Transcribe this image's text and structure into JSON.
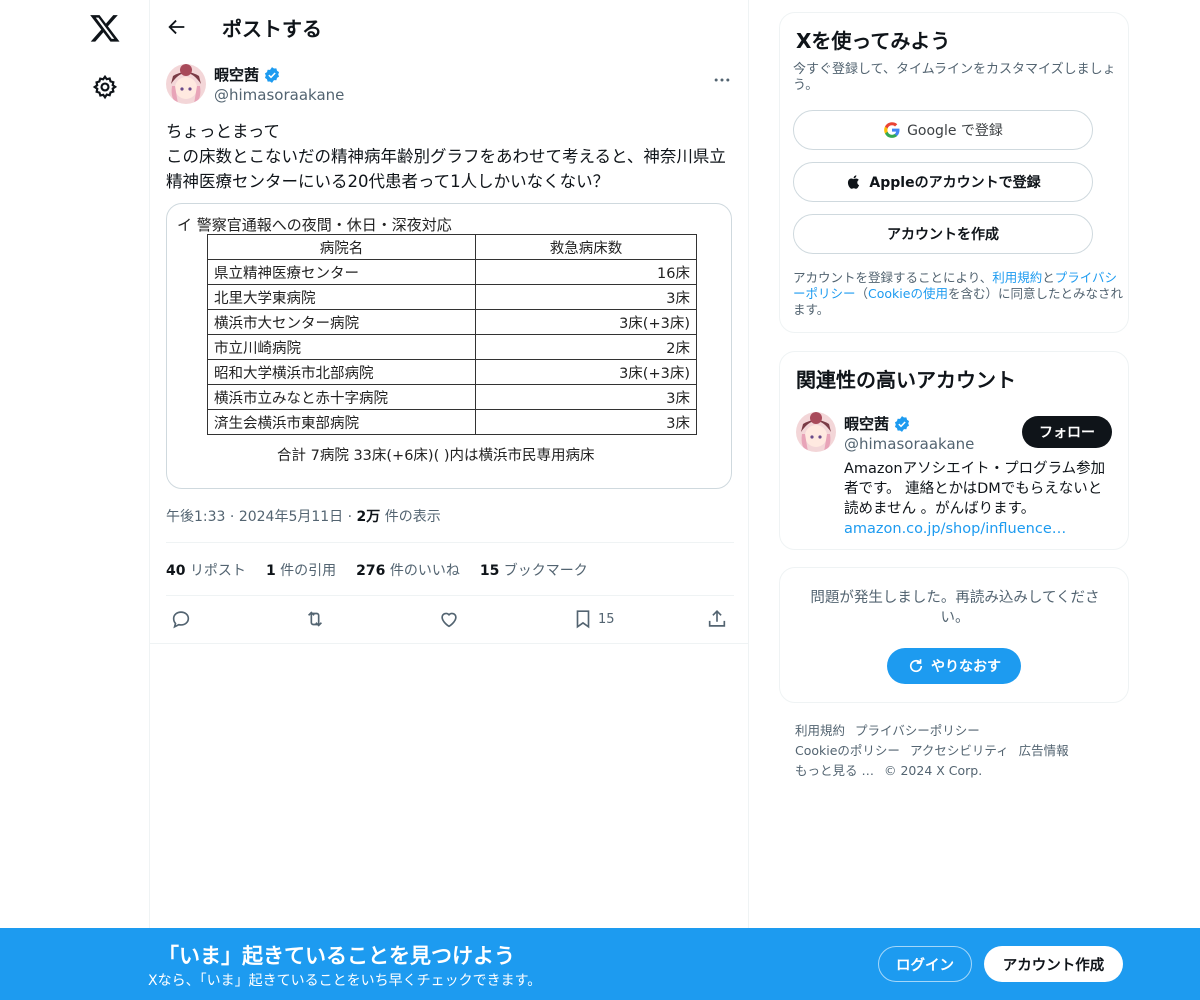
{
  "header": {
    "title": "ポストする"
  },
  "tweet": {
    "author_name": "暇空茜",
    "author_handle": "@himasoraakane",
    "text": "ちょっとまって\nこの床数とこないだの精神病年齢別グラフをあわせて考えると、神奈川県立精神医療センターにいる20代患者って1人しかいなくない？",
    "image": {
      "caption": "イ  警察官通報への夜間・休日・深夜対応",
      "columns": [
        "病院名",
        "救急病床数"
      ],
      "rows": [
        [
          "県立精神医療センター",
          "16床"
        ],
        [
          "北里大学東病院",
          "3床"
        ],
        [
          "横浜市大センター病院",
          "3床(+3床)"
        ],
        [
          "市立川崎病院",
          "2床"
        ],
        [
          "昭和大学横浜市北部病院",
          "3床(+3床)"
        ],
        [
          "横浜市立みなと赤十字病院",
          "3床"
        ],
        [
          "済生会横浜市東部病院",
          "3床"
        ]
      ],
      "total": "合計  7病院  33床(+6床)(  )内は横浜市民専用病床"
    },
    "time": "午後1:33",
    "date": "2024年5月11日",
    "views_count": "2万",
    "views_label": "件の表示",
    "stats": {
      "reposts_count": "40",
      "reposts_label": "リポスト",
      "quotes_count": "1",
      "quotes_label": "件の引用",
      "likes_count": "276",
      "likes_label": "件のいいね",
      "bookmarks_count": "15",
      "bookmarks_label": "ブックマーク"
    },
    "bookmark_action_count": "15"
  },
  "signup_card": {
    "title": "Xを使ってみよう",
    "subtitle": "今すぐ登録して、タイムラインをカスタマイズしましょう。",
    "google_label": "Google で登録",
    "apple_label": "Appleのアカウントで登録",
    "create_label": "アカウントを作成",
    "legal_1": "アカウントを登録することにより、",
    "legal_terms": "利用規約",
    "legal_and": "と",
    "legal_privacy": "プライバシーポリシー",
    "legal_open": "（",
    "legal_cookie": "Cookieの使用",
    "legal_2": "を含む）に同意したとみなされます。"
  },
  "related": {
    "title": "関連性の高いアカウント",
    "name": "暇空茜",
    "handle": "@himasoraakane",
    "follow_label": "フォロー",
    "bio": "Amazonアソシエイト・プログラム参加者です。 連絡とかはDMでもらえないと読めません 。がんばります。",
    "bio_link": "amazon.co.jp/shop/influence…"
  },
  "error_card": {
    "message": "問題が発生しました。再読み込みしてください。",
    "retry_label": "やりなおす"
  },
  "footer": {
    "terms": "利用規約",
    "privacy": "プライバシーポリシー",
    "cookie": "Cookieのポリシー",
    "accessibility": "アクセシビリティ",
    "ads": "広告情報",
    "more": "もっと見る …",
    "copyright": "© 2024 X Corp."
  },
  "banner": {
    "title": "「いま」起きていることを見つけよう",
    "subtitle": "Xなら、「いま」起きていることをいち早くチェックできます。",
    "login_label": "ログイン",
    "signup_label": "アカウント作成"
  },
  "colors": {
    "accent": "#1d9bf0",
    "text": "#0f1419",
    "muted": "#536471"
  },
  "icons": [
    "x-logo-icon",
    "gear-icon",
    "back-arrow-icon",
    "verified-icon",
    "more-icon",
    "reply-icon",
    "repost-icon",
    "like-icon",
    "bookmark-icon",
    "share-icon",
    "google-icon",
    "apple-icon",
    "refresh-icon"
  ]
}
